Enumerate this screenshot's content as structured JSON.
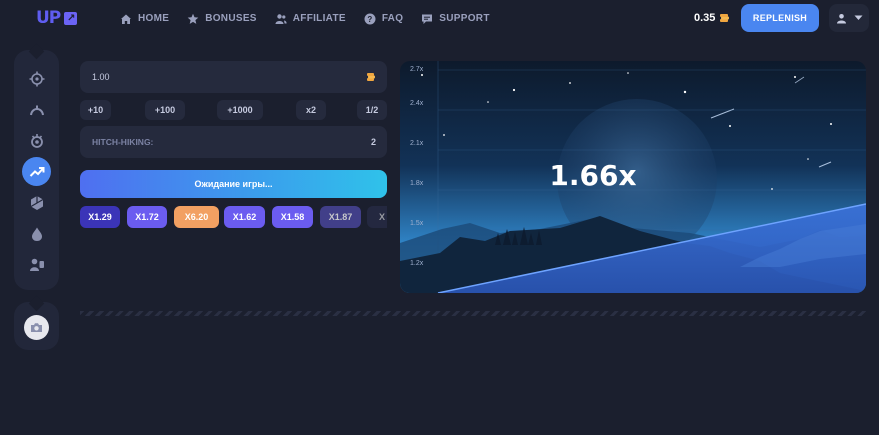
{
  "logo": {
    "text": "UP"
  },
  "nav": {
    "items": [
      {
        "label": "HOME",
        "icon": "home-icon"
      },
      {
        "label": "BONUSES",
        "icon": "star-icon"
      },
      {
        "label": "AFFILIATE",
        "icon": "users-icon"
      },
      {
        "label": "FAQ",
        "icon": "question-icon"
      },
      {
        "label": "SUPPORT",
        "icon": "chat-icon"
      }
    ]
  },
  "header": {
    "balance": "0.35",
    "replenish_label": "REPLENISH"
  },
  "sidebar": {
    "items": [
      {
        "icon": "crosshair-icon",
        "active": false
      },
      {
        "icon": "arc-icon",
        "active": false
      },
      {
        "icon": "bomb-icon",
        "active": false
      },
      {
        "icon": "trend-up-icon",
        "active": true
      },
      {
        "icon": "hexagon-icon",
        "active": false
      },
      {
        "icon": "drop-icon",
        "active": false
      },
      {
        "icon": "person-icon",
        "active": false
      }
    ],
    "bottom_icon": "camera-icon"
  },
  "bet": {
    "amount": "1.00",
    "quick": [
      "+10",
      "+100",
      "+1000",
      "x2",
      "1/2"
    ],
    "hitch_label": "HITCH-HIKING:",
    "hitch_value": "2",
    "wait_label": "Ожидание игры..."
  },
  "history": [
    {
      "value": "X1.29",
      "color": "#3b34b8"
    },
    {
      "value": "X1.72",
      "color": "#6b5cf0"
    },
    {
      "value": "X6.20",
      "color": "#f2a062"
    },
    {
      "value": "X1.62",
      "color": "#6b5cf0"
    },
    {
      "value": "X1.58",
      "color": "#6b5cf0"
    },
    {
      "value": "X1.87",
      "color": "#4e4aa8"
    },
    {
      "value": "X",
      "color": "#2c3050"
    }
  ],
  "game": {
    "multiplier": "1.66x",
    "y_ticks": [
      "2.7x",
      "2.4x",
      "2.1x",
      "1.8x",
      "1.5x",
      "1.2x"
    ]
  },
  "colors": {
    "accent": "#4a86f0",
    "background": "#1b1f2e",
    "panel": "#252a3d"
  }
}
